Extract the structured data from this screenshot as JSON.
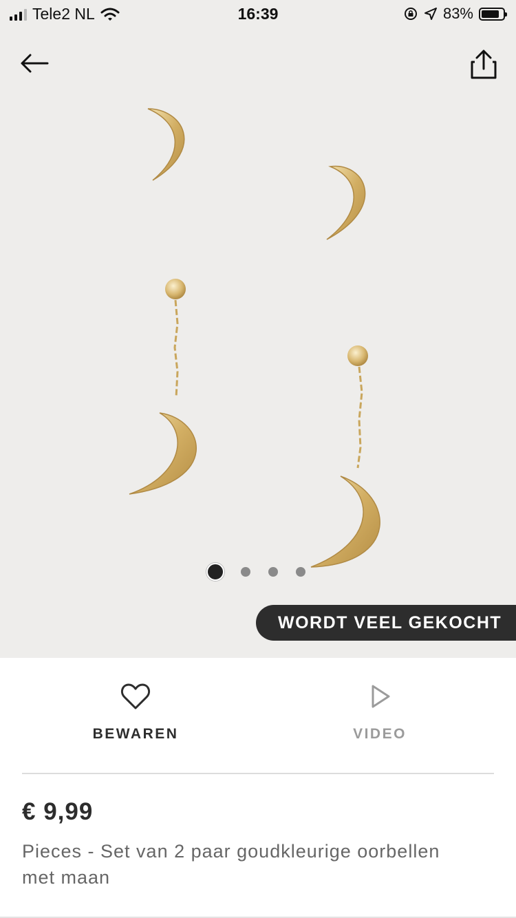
{
  "status_bar": {
    "carrier": "Tele2 NL",
    "time": "16:39",
    "battery_percent": "83%",
    "battery_level": 0.83
  },
  "nav": {
    "back_icon": "arrow-left-icon",
    "share_icon": "share-icon"
  },
  "gallery": {
    "image_count": 4,
    "active_index": 0,
    "badge": "WORDT VEEL GEKOCHT"
  },
  "actions": {
    "save_label": "BEWAREN",
    "save_icon": "heart-icon",
    "video_label": "VIDEO",
    "video_icon": "play-icon"
  },
  "product": {
    "price": "€ 9,99",
    "title": "Pieces - Set van 2 paar goudkleurige oorbellen met maan"
  },
  "colors": {
    "hero_bg": "#eeedeb",
    "badge_bg": "#2d2d2d",
    "gold": "#d8b770",
    "text_dark": "#2d2d2d",
    "text_muted": "#9b9b9b"
  }
}
